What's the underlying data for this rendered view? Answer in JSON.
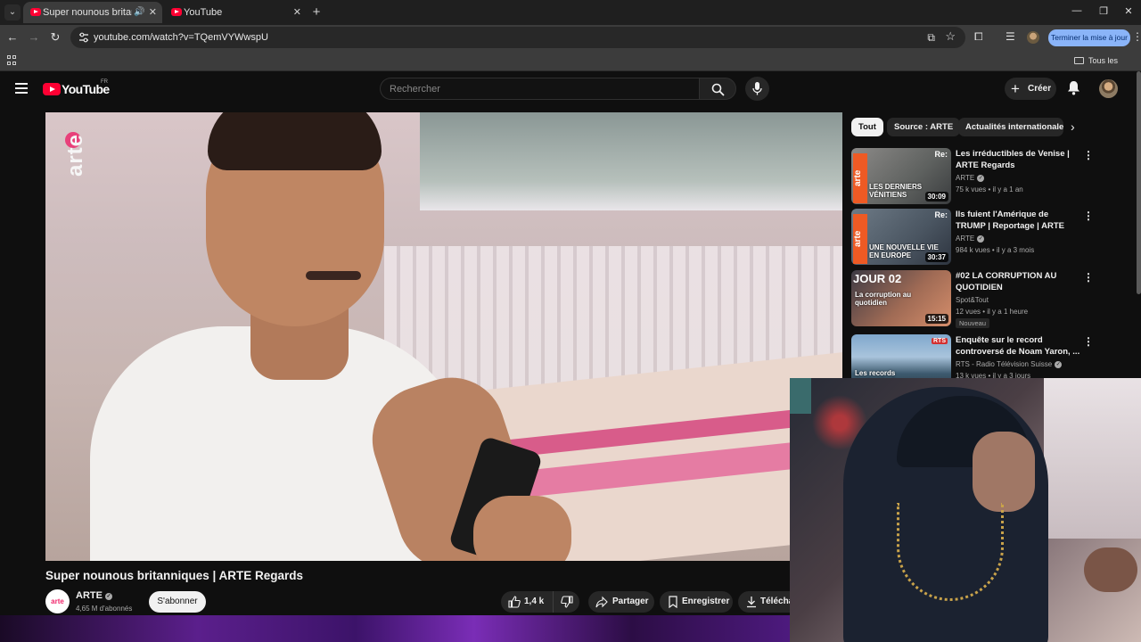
{
  "browser": {
    "tabs": [
      {
        "title": "Super nounous britanniques",
        "active": true
      },
      {
        "title": "YouTube",
        "active": false
      }
    ],
    "url": "youtube.com/watch?v=TQemVYWwspU",
    "update_button": "Terminer la mise à jour",
    "all_bookmarks": "Tous les favoris"
  },
  "masthead": {
    "logo_text": "YouTube",
    "country_code": "FR",
    "search_placeholder": "Rechercher",
    "create_label": "Créer"
  },
  "video": {
    "title": "Super nounous britanniques | ARTE Regards",
    "channel": "ARTE",
    "channel_avatar_text": "arte",
    "subscribers": "4,65 M d'abonnés",
    "subscribe_label": "S'abonner",
    "likes": "1,4 k",
    "share_label": "Partager",
    "save_label": "Enregistrer",
    "download_label": "Téléchar",
    "overlay_logo": "arte"
  },
  "sidebar": {
    "chips": [
      "Tout",
      "Source : ARTE",
      "Actualités internationales"
    ],
    "recommendations": [
      {
        "title": "Les irréductibles de Venise | ARTE Regards",
        "channel": "ARTE",
        "verified": true,
        "views": "75 k vues",
        "age": "il y a 1 an",
        "duration": "30:09",
        "thumb_text": "LES DERNIERS VÉNITIENS",
        "thumb_tag": "Re:"
      },
      {
        "title": "Ils fuient l'Amérique de TRUMP | Reportage | ARTE Regards",
        "channel": "ARTE",
        "verified": true,
        "views": "984 k vues",
        "age": "il y a 3 mois",
        "duration": "30:37",
        "thumb_text": "UNE NOUVELLE VIE EN EUROPE",
        "thumb_tag": "Re:"
      },
      {
        "title": "#02 LA CORRUPTION AU QUOTIDIEN",
        "channel": "Spot&Tout",
        "verified": false,
        "views": "12 vues",
        "age": "il y a 1 heure",
        "duration": "15:15",
        "thumb_text": "La corruption au quotidien",
        "thumb_heading": "JOUR 02",
        "badge": "Nouveau"
      },
      {
        "title": "Enquête sur le record controversé de Noam Yaron, ...",
        "channel": "RTS - Radio Télévision Suisse",
        "verified": true,
        "views": "13 k vues",
        "age": "il y a 3 jours",
        "duration": "",
        "thumb_text": "Les records contestés de",
        "thumb_tag": "RTS"
      }
    ]
  },
  "icons": {
    "back": "arrow-left-icon",
    "forward": "arrow-right-icon",
    "reload": "reload-icon",
    "search": "search-icon",
    "mic": "mic-icon",
    "bell": "bell-icon"
  },
  "colors": {
    "youtube_red": "#ff0033",
    "background": "#0f0f0f",
    "update_button": "#8ab4f8",
    "arte_pink": "#e8407a"
  }
}
